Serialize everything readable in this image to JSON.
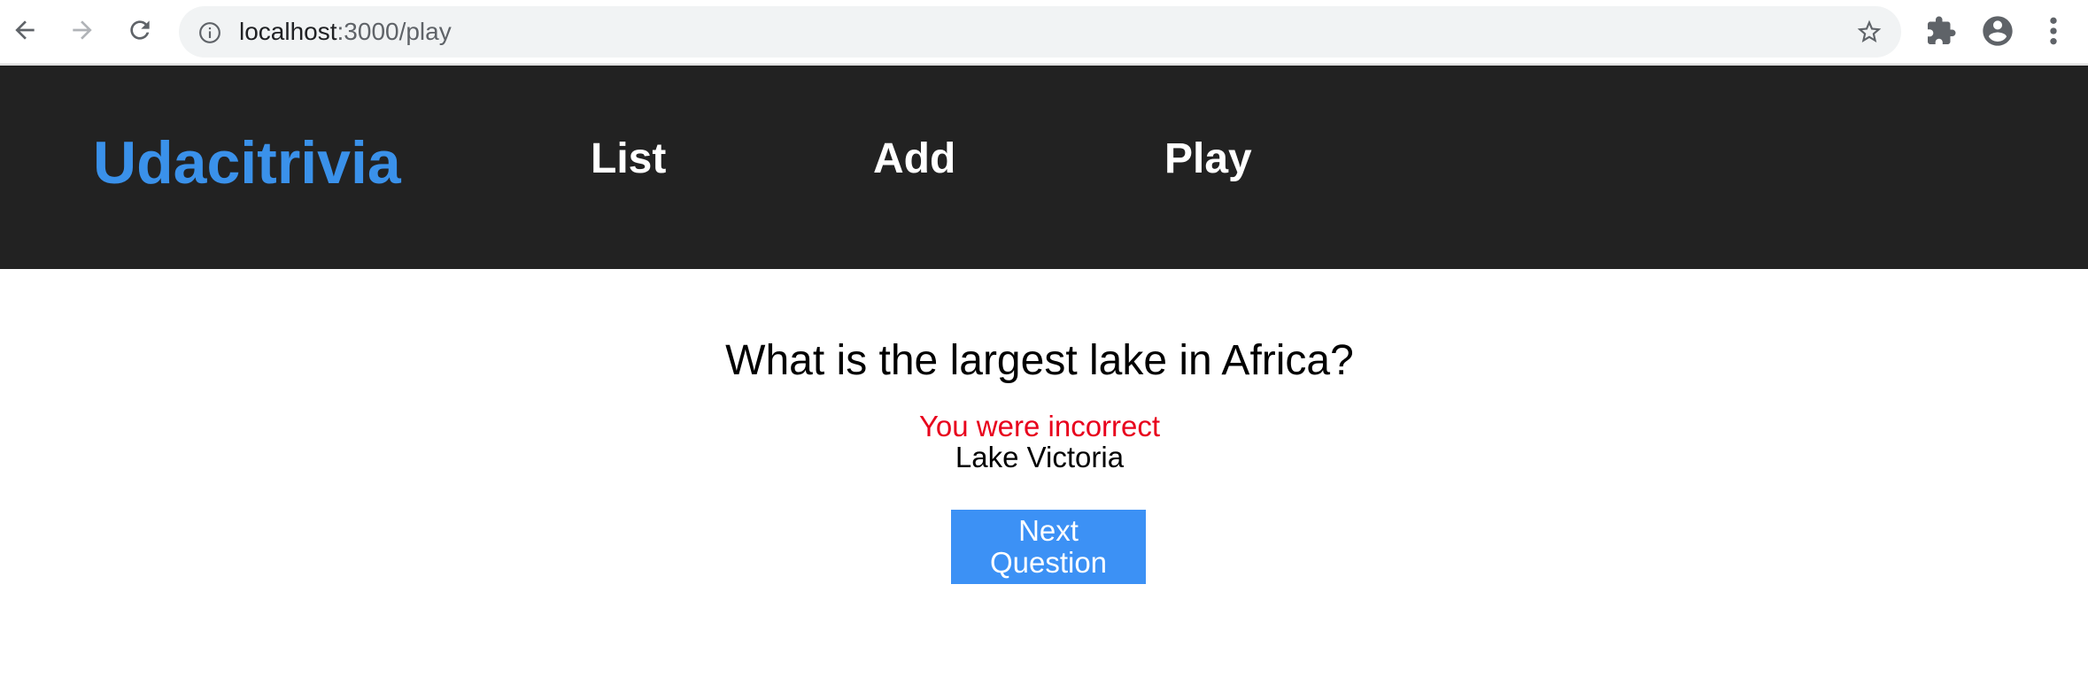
{
  "browser": {
    "url_host": "localhost",
    "url_rest": ":3000/play"
  },
  "header": {
    "brand": "Udacitrivia",
    "nav": {
      "list": "List",
      "add": "Add",
      "play": "Play"
    }
  },
  "quiz": {
    "question": "What is the largest lake in Africa?",
    "result": "You were incorrect",
    "answer": "Lake Victoria",
    "next_button": "Next Question"
  },
  "colors": {
    "brand": "#3a91ea",
    "header_bg": "#222222",
    "incorrect": "#e8001c",
    "button_bg": "#3c91f5"
  },
  "icons": {
    "back": "arrow-left-icon",
    "forward": "arrow-right-icon",
    "reload": "reload-icon",
    "info": "info-icon",
    "bookmark": "star-icon",
    "extensions": "puzzle-icon",
    "profile": "account-circle-icon",
    "menu": "kebab-menu-icon"
  }
}
